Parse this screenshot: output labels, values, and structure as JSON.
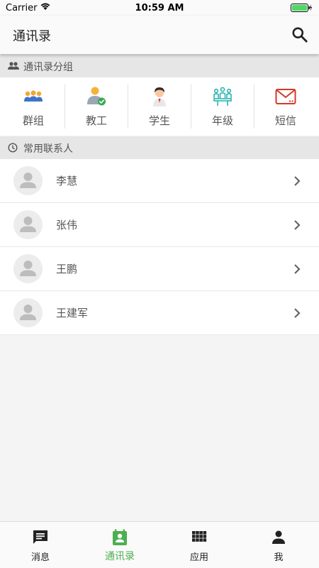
{
  "status_bar": {
    "carrier": "Carrier",
    "time": "10:59 AM"
  },
  "header": {
    "title": "通讯录"
  },
  "groups_section": {
    "title": "通讯录分组"
  },
  "groups": [
    {
      "label": "群组",
      "icon": "group-people-icon"
    },
    {
      "label": "教工",
      "icon": "staff-verified-icon"
    },
    {
      "label": "学生",
      "icon": "student-icon"
    },
    {
      "label": "年级",
      "icon": "grade-icon"
    },
    {
      "label": "短信",
      "icon": "sms-envelope-icon"
    }
  ],
  "recent_section": {
    "title": "常用联系人"
  },
  "contacts": [
    {
      "name": "李慧"
    },
    {
      "name": "张伟"
    },
    {
      "name": "王鹏"
    },
    {
      "name": "王建军"
    }
  ],
  "bottom_nav": [
    {
      "label": "消息",
      "icon": "message-icon",
      "active": false
    },
    {
      "label": "通讯录",
      "icon": "contacts-icon",
      "active": true
    },
    {
      "label": "应用",
      "icon": "apps-grid-icon",
      "active": false
    },
    {
      "label": "我",
      "icon": "person-icon",
      "active": false
    }
  ],
  "colors": {
    "accent": "#4caf50",
    "header_bg": "#fafafa",
    "section_bg": "#e6e6e6"
  }
}
